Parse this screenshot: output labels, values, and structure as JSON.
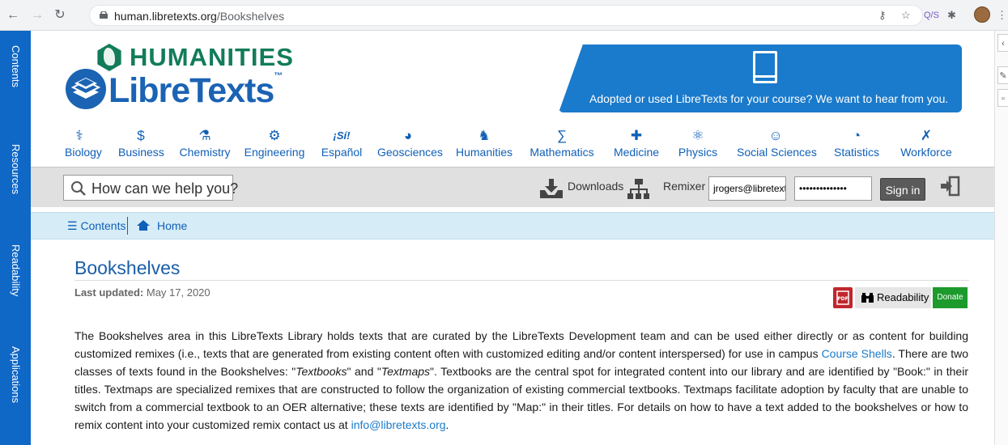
{
  "browser": {
    "url_host": "human.libretexts.org",
    "url_path": "/Bookshelves",
    "ext_label": "Q/S"
  },
  "sidebar": {
    "items": [
      {
        "label": "Contents"
      },
      {
        "label": "Resources"
      },
      {
        "label": "Readability"
      },
      {
        "label": "Applications"
      }
    ]
  },
  "header": {
    "humanities_title": "HUMANITIES",
    "libretexts_title": "LibreTexts",
    "trademark": "™",
    "banner_text": "Adopted or used LibreTexts for your course? We want to hear from you."
  },
  "subjects": [
    {
      "label": "Biology",
      "icon": "biology-icon",
      "glyph": "⚕"
    },
    {
      "label": "Business",
      "icon": "dollar-icon",
      "glyph": "$"
    },
    {
      "label": "Chemistry",
      "icon": "flask-icon",
      "glyph": "⚗"
    },
    {
      "label": "Engineering",
      "icon": "gear-icon",
      "glyph": "⚙"
    },
    {
      "label": "Español",
      "icon": "si-icon",
      "glyph": "¡Sí!"
    },
    {
      "label": "Geosciences",
      "icon": "globe-icon",
      "glyph": "◕"
    },
    {
      "label": "Humanities",
      "icon": "head-icon",
      "glyph": "♞"
    },
    {
      "label": "Mathematics",
      "icon": "sigma-icon",
      "glyph": "∑"
    },
    {
      "label": "Medicine",
      "icon": "cross-icon",
      "glyph": "✚"
    },
    {
      "label": "Physics",
      "icon": "atom-icon",
      "glyph": "⚛"
    },
    {
      "label": "Social Sciences",
      "icon": "people-icon",
      "glyph": "☺"
    },
    {
      "label": "Statistics",
      "icon": "chart-icon",
      "glyph": "◔"
    },
    {
      "label": "Workforce",
      "icon": "tools-icon",
      "glyph": "✗"
    }
  ],
  "toolbar": {
    "search_placeholder": "How can we help you?",
    "downloads_label": "Downloads",
    "remixer_label": "Remixer",
    "username_value": "jrogers@libretexts",
    "password_value": "••••••••••••••",
    "signin_label": "Sign in"
  },
  "breadcrumb": {
    "contents_label": "Contents",
    "home_label": "Home"
  },
  "page": {
    "title": "Bookshelves",
    "updated_label": "Last updated:",
    "updated_date": "May 17, 2020",
    "readability_label": "Readability",
    "donate_label": "Donate"
  },
  "body": {
    "p1": "The Bookshelves area in this LibreTexts Library holds texts that are curated by the LibreTexts Development team and can be used either directly or as content for building customized remixes (i.e., texts that are generated from existing content often with customized editing and/or content interspersed) for use in campus ",
    "link1": "Course Shells",
    "p2": ". There are two classes of texts found in the Bookshelves: \"",
    "em1": "Textbooks",
    "p3": "\" and \"",
    "em2": "Textmaps",
    "p4": "\". Textbooks are the central spot for integrated content into our library and are identified by \"Book:\" in their titles. Textmaps are specialized remixes that are constructed to follow the organization of existing commercial textbooks. Textmaps facilitate adoption by faculty that are unable to switch from a commercial textbook to an OER alternative; these texts are identified by \"Map:\" in their titles. For details on how to have a text added to the bookshelves or how to remix content into your customized remix contact us at ",
    "link2": "info@libretexts.org",
    "p5": "."
  }
}
